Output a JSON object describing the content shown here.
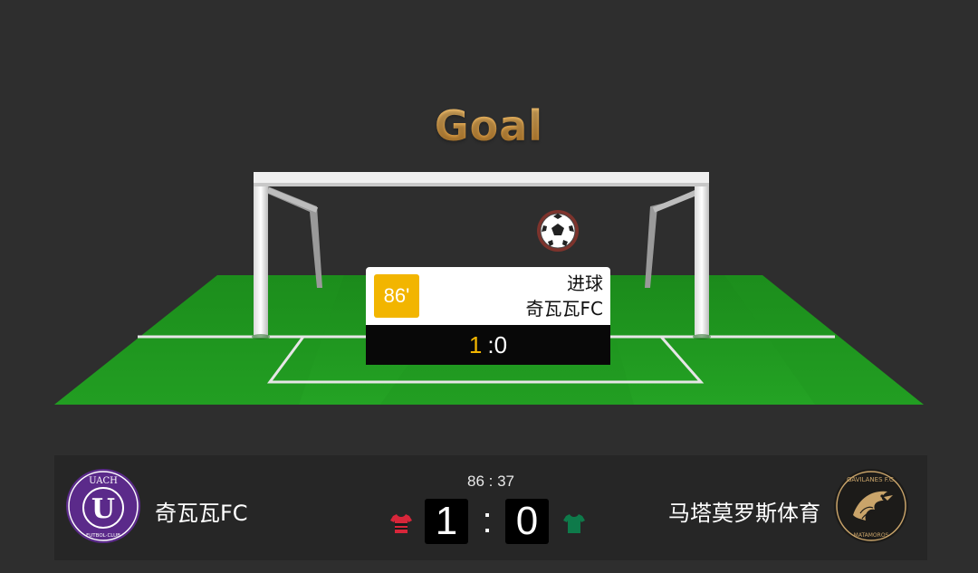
{
  "scene": {
    "title": "Goal"
  },
  "event": {
    "minute": "86'",
    "type": "进球",
    "team": "奇瓦瓦FC",
    "score_highlight": "1",
    "score_rest": ":0"
  },
  "scoreboard": {
    "clock": "86 : 37",
    "home": {
      "name": "奇瓦瓦FC",
      "score": "1",
      "shirt_color": "#d8263a",
      "logo_color": "#5b2a8a",
      "logo_text_top": "UACH",
      "logo_text_mid": "U",
      "logo_text_bottom": "FUTBOL·CLUB"
    },
    "away": {
      "name": "马塔莫罗斯体育",
      "score": "0",
      "shirt_color": "#0e7a4a",
      "logo_color": "#1c1b19",
      "logo_text_top": "GAVILANES F.C.",
      "logo_text_bottom": "MATAMOROS"
    },
    "separator": ":"
  },
  "colors": {
    "accent_gold": "#f2b500",
    "pitch_green": "#1e8e1e",
    "background": "#2e2e2e"
  }
}
